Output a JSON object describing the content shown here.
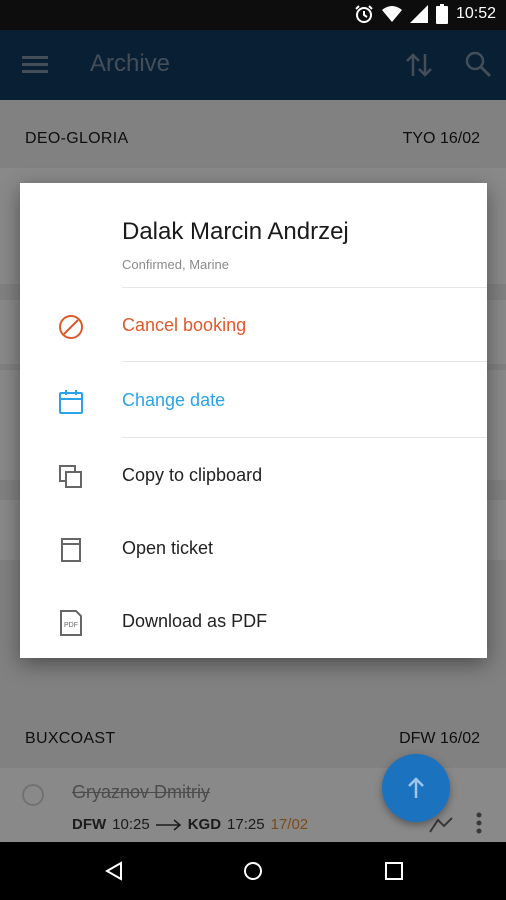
{
  "status_bar": {
    "time": "10:52",
    "icons": [
      "alarm-icon",
      "wifi-icon",
      "cell-signal-icon",
      "battery-icon"
    ]
  },
  "app_bar": {
    "title": "Archive",
    "icons": [
      "menu-icon",
      "sort-icon",
      "search-icon"
    ]
  },
  "list": {
    "groups": [
      {
        "name": "DEO-GLORIA",
        "dest_code": "TYO",
        "dest_date": "16/02"
      },
      {
        "name": "BUXCOAST",
        "dest_code": "DFW",
        "dest_date": "16/02"
      }
    ],
    "rows": [
      {
        "passenger": "Gryaznov Dmitriy",
        "from_code": "DFW",
        "from_time": "10:25",
        "to_code": "KGD",
        "to_time": "17:25",
        "arrival_date": "17/02"
      }
    ]
  },
  "dialog": {
    "name": "Dalak Marcin Andrzej",
    "subtitle": "Confirmed, Marine",
    "actions": [
      {
        "label": "Cancel booking",
        "icon": "cancel-icon",
        "color": "#e0592a"
      },
      {
        "label": "Change date",
        "icon": "calendar-icon",
        "color": "#2aa3e8"
      },
      {
        "label": "Copy to clipboard",
        "icon": "copy-icon",
        "color": "#222222"
      },
      {
        "label": "Open ticket",
        "icon": "ticket-icon",
        "color": "#222222"
      },
      {
        "label": "Download as PDF",
        "icon": "pdf-icon",
        "color": "#222222"
      }
    ],
    "pdf_icon_text": "PDF"
  },
  "colors": {
    "app_bar": "#123a5e",
    "fab": "#1b73bf",
    "accent_orange": "#e0892e"
  }
}
